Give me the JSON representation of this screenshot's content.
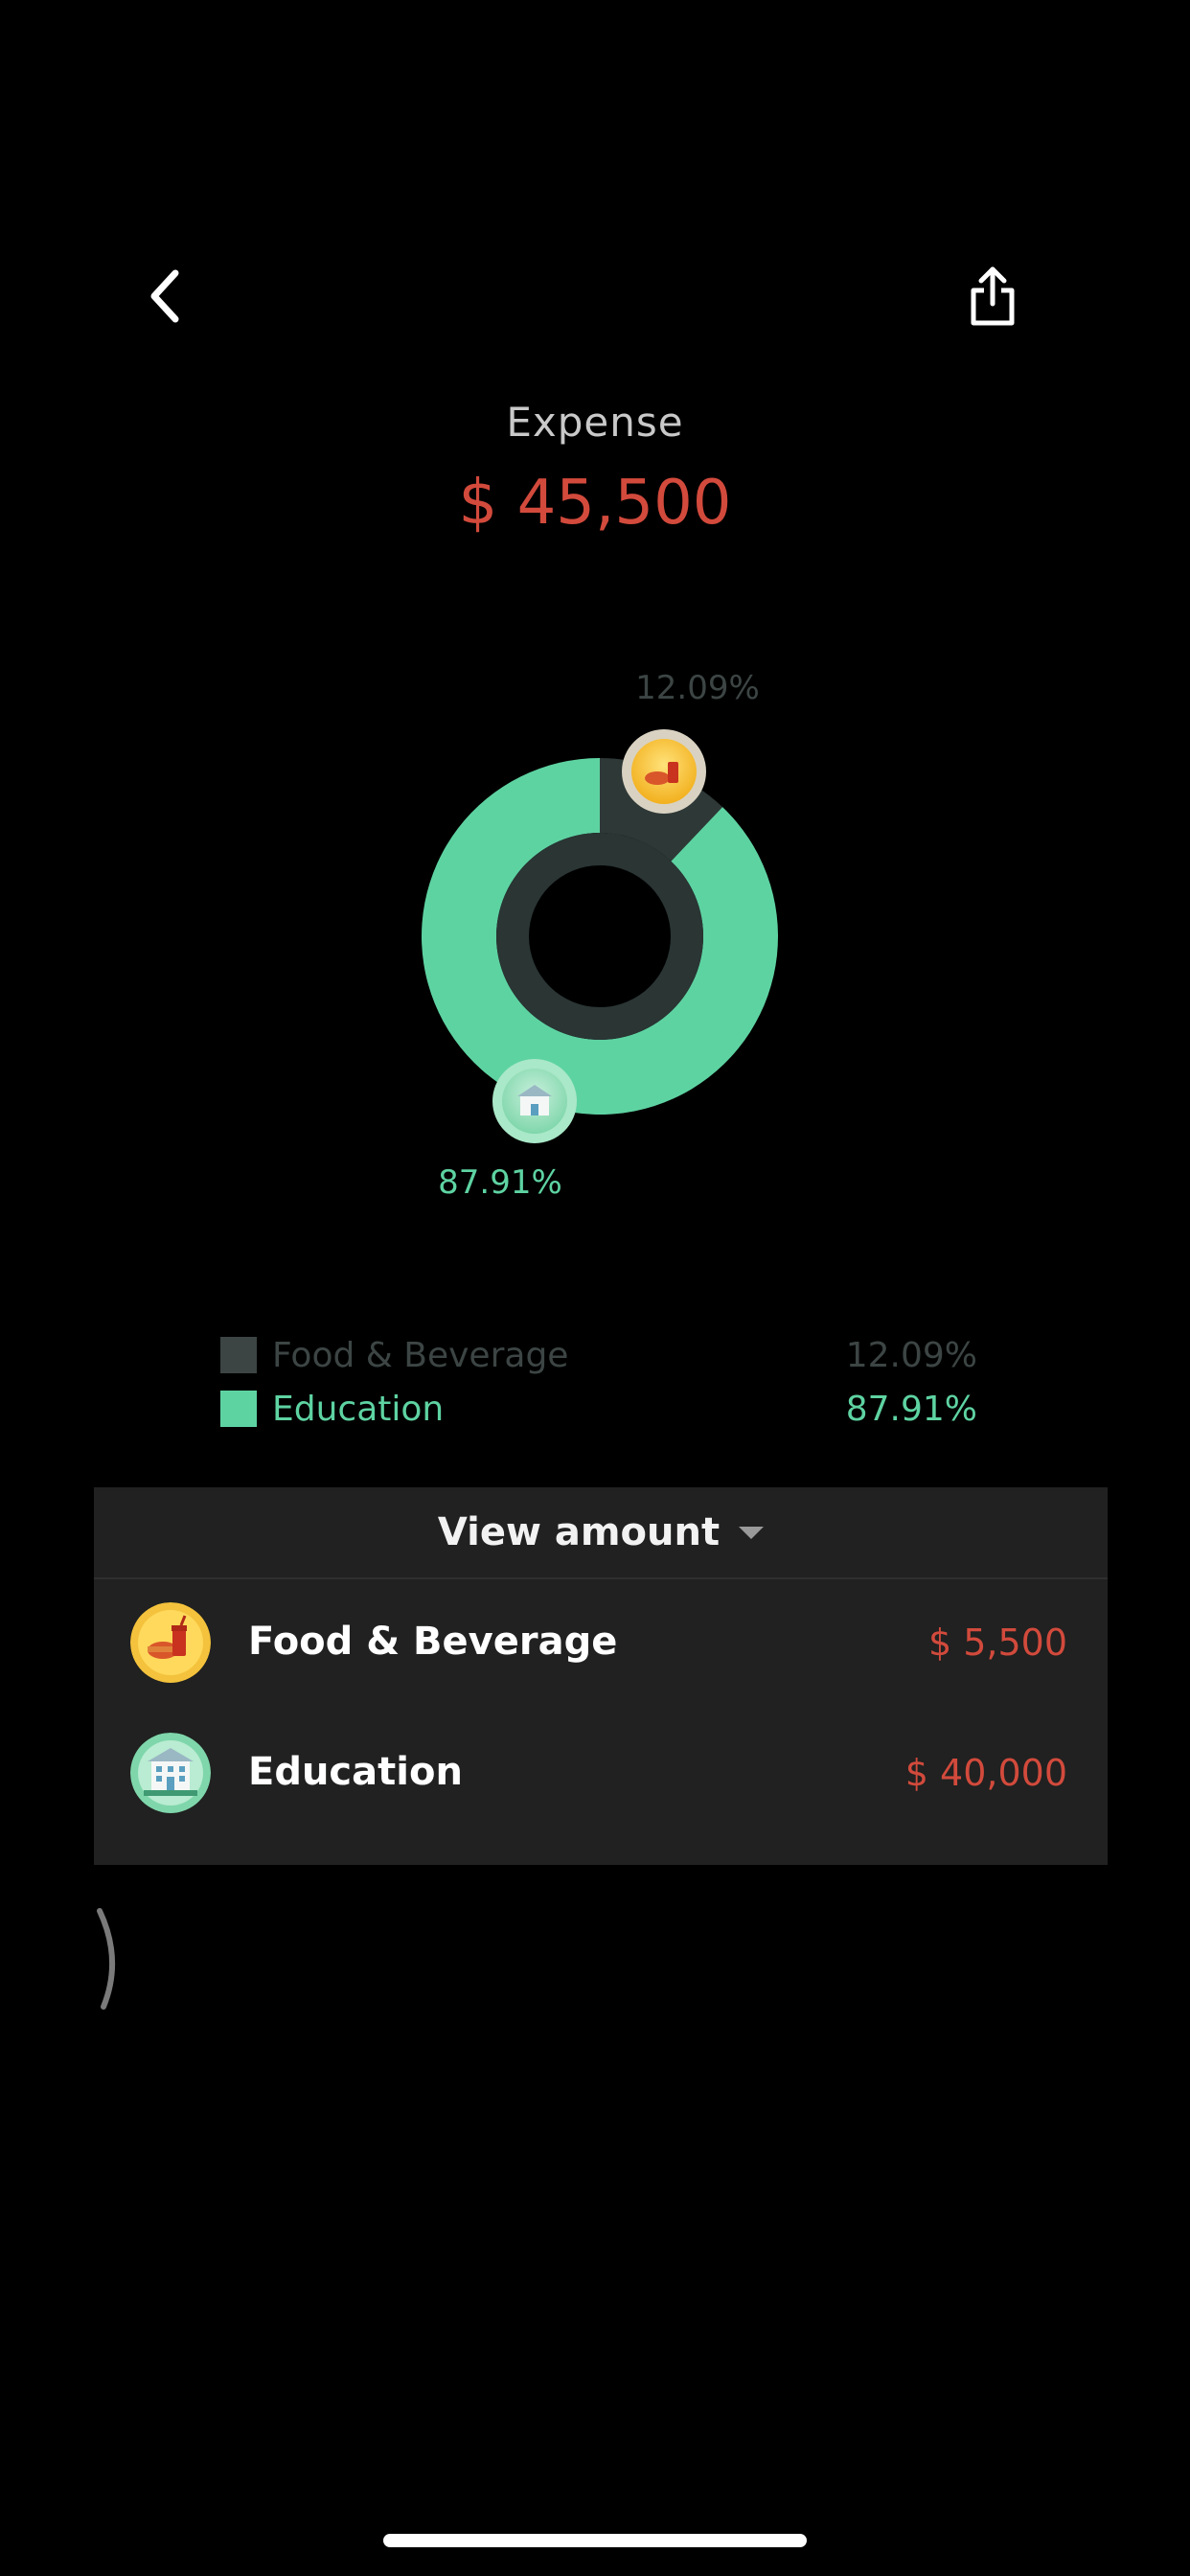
{
  "nav": {
    "back_icon": "chevron-left-icon",
    "share_icon": "share-icon"
  },
  "header": {
    "label": "Expense",
    "total": "$ 45,500"
  },
  "colors": {
    "background": "#000000",
    "food_beverage": "#3c4544",
    "education": "#5ed3a2",
    "amount_red": "#d24a3c",
    "panel": "#202120"
  },
  "chart_data": {
    "type": "pie",
    "variant": "donut",
    "categories": [
      "Food & Beverage",
      "Education"
    ],
    "values": [
      12.09,
      87.91
    ],
    "labels": [
      "12.09%",
      "87.91%"
    ],
    "colors": [
      "#3c4544",
      "#5ed3a2"
    ],
    "icons": [
      "food-beverage-icon",
      "education-icon"
    ]
  },
  "legend": [
    {
      "name": "Food & Beverage",
      "percent": "12.09%"
    },
    {
      "name": "Education",
      "percent": "87.91%"
    }
  ],
  "amounts": {
    "toggle_label": "View amount",
    "rows": [
      {
        "name": "Food & Beverage",
        "amount": "$ 5,500",
        "icon": "food-beverage-icon"
      },
      {
        "name": "Education",
        "amount": "$ 40,000",
        "icon": "education-icon"
      }
    ]
  }
}
